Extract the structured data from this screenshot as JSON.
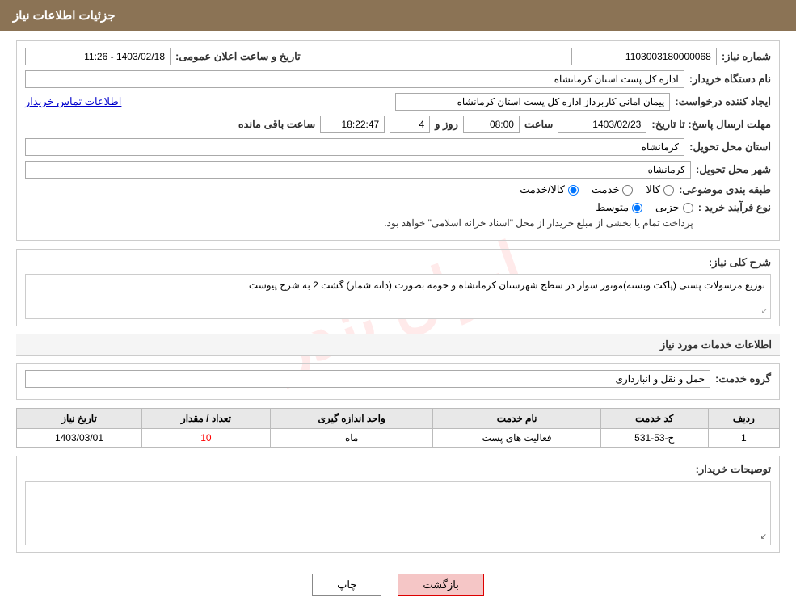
{
  "header": {
    "title": "جزئیات اطلاعات نیاز"
  },
  "form": {
    "shomareNiaz_label": "شماره نیاز:",
    "shomareNiaz_value": "1103003180000068",
    "namDastgah_label": "نام دستگاه خریدار:",
    "namDastgah_value": "اداره کل پست استان کرمانشاه",
    "tarikh_label": "تاریخ و ساعت اعلان عمومی:",
    "tarikh_value": "1403/02/18 - 11:26",
    "ijadKonande_label": "ایجاد کننده درخواست:",
    "ijadKonande_value": "پیمان امانی کاربرداز اداره کل پست استان کرمانشاه",
    "ettelaat_link": "اطلاعات تماس خریدار",
    "mohlat_label": "مهلت ارسال پاسخ: تا تاریخ:",
    "mohlat_date": "1403/02/23",
    "mohlat_saat_label": "ساعت",
    "mohlat_saat": "08:00",
    "mohlat_roz_label": "روز و",
    "mohlat_roz": "4",
    "mohlat_baqi_label": "ساعت باقی مانده",
    "mohlat_baqi": "18:22:47",
    "ostan_label": "استان محل تحویل:",
    "ostan_value": "کرمانشاه",
    "shahr_label": "شهر محل تحویل:",
    "shahr_value": "کرمانشاه",
    "tabaqe_label": "طبقه بندی موضوعی:",
    "tabaqe_radio1": "کالا",
    "tabaqe_radio2": "خدمت",
    "tabaqe_radio3": "کالا/خدمت",
    "noFarayand_label": "نوع فرآیند خرید :",
    "noFarayand_radio1": "جزیی",
    "noFarayand_radio2": "متوسط",
    "noFarayand_note": "پرداخت تمام یا بخشی از مبلغ خریدار از محل \"اسناد خزانه اسلامی\" خواهد بود.",
    "sharh_label": "شرح کلی نیاز:",
    "sharh_value": "توزیع مرسولات پستی (پاکت وبسته)موتور سوار در سطح شهرستان کرمانشاه و حومه بصورت (دانه شمار)\nگشت 2 به شرح پیوست",
    "khadamat_group_label": "گروه خدمت:",
    "khadamat_group_value": "حمل و نقل و انبارداری",
    "table_headers": [
      "ردیف",
      "کد خدمت",
      "نام خدمت",
      "واحد اندازه گیری",
      "تعداد / مقدار",
      "تاریخ نیاز"
    ],
    "table_rows": [
      {
        "radif": "1",
        "code": "ج-53-531",
        "name": "فعالیت های پست",
        "unit": "ماه",
        "count": "10",
        "date": "1403/03/01"
      }
    ],
    "toseif_label": "توصیحات خریدار:",
    "btn_chap": "چاپ",
    "btn_bazgasht": "بازگشت"
  }
}
